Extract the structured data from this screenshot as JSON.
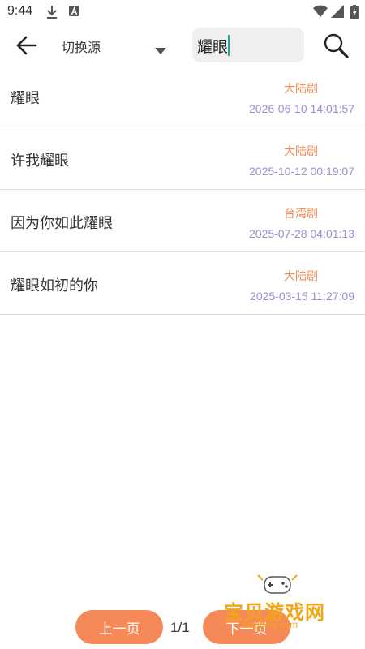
{
  "status_bar": {
    "time": "9:44",
    "left_icons": [
      "download-icon",
      "a-badge-icon"
    ],
    "right_icons": [
      "wifi-icon",
      "signal-icon",
      "battery-icon"
    ]
  },
  "toolbar": {
    "back_icon": "arrow-left-icon",
    "source_label": "切换源",
    "dropdown_icon": "triangle-down-icon",
    "search_value": "耀眼",
    "search_icon": "magnifier-icon"
  },
  "results": [
    {
      "title": "耀眼",
      "region": "大陆剧",
      "date": "2026-06-10 14:01:57"
    },
    {
      "title": "许我耀眼",
      "region": "大陆剧",
      "date": "2025-10-12 00:19:07"
    },
    {
      "title": "因为你如此耀眼",
      "region": "台湾剧",
      "date": "2025-07-28 04:01:13"
    },
    {
      "title": "耀眼如初的你",
      "region": "大陆剧",
      "date": "2025-03-15 11:27:09"
    }
  ],
  "pagination": {
    "prev_label": "上一页",
    "page_indicator": "1/1",
    "next_label": "下一页"
  },
  "watermark": {
    "text": "宝贝游戏网",
    "url": "baobeiy.com"
  },
  "colors": {
    "accent": "#f58a58",
    "region": "#ef8a55",
    "date": "#9b8ed3",
    "caret": "#1aa89a",
    "watermark": "#f2a516"
  }
}
